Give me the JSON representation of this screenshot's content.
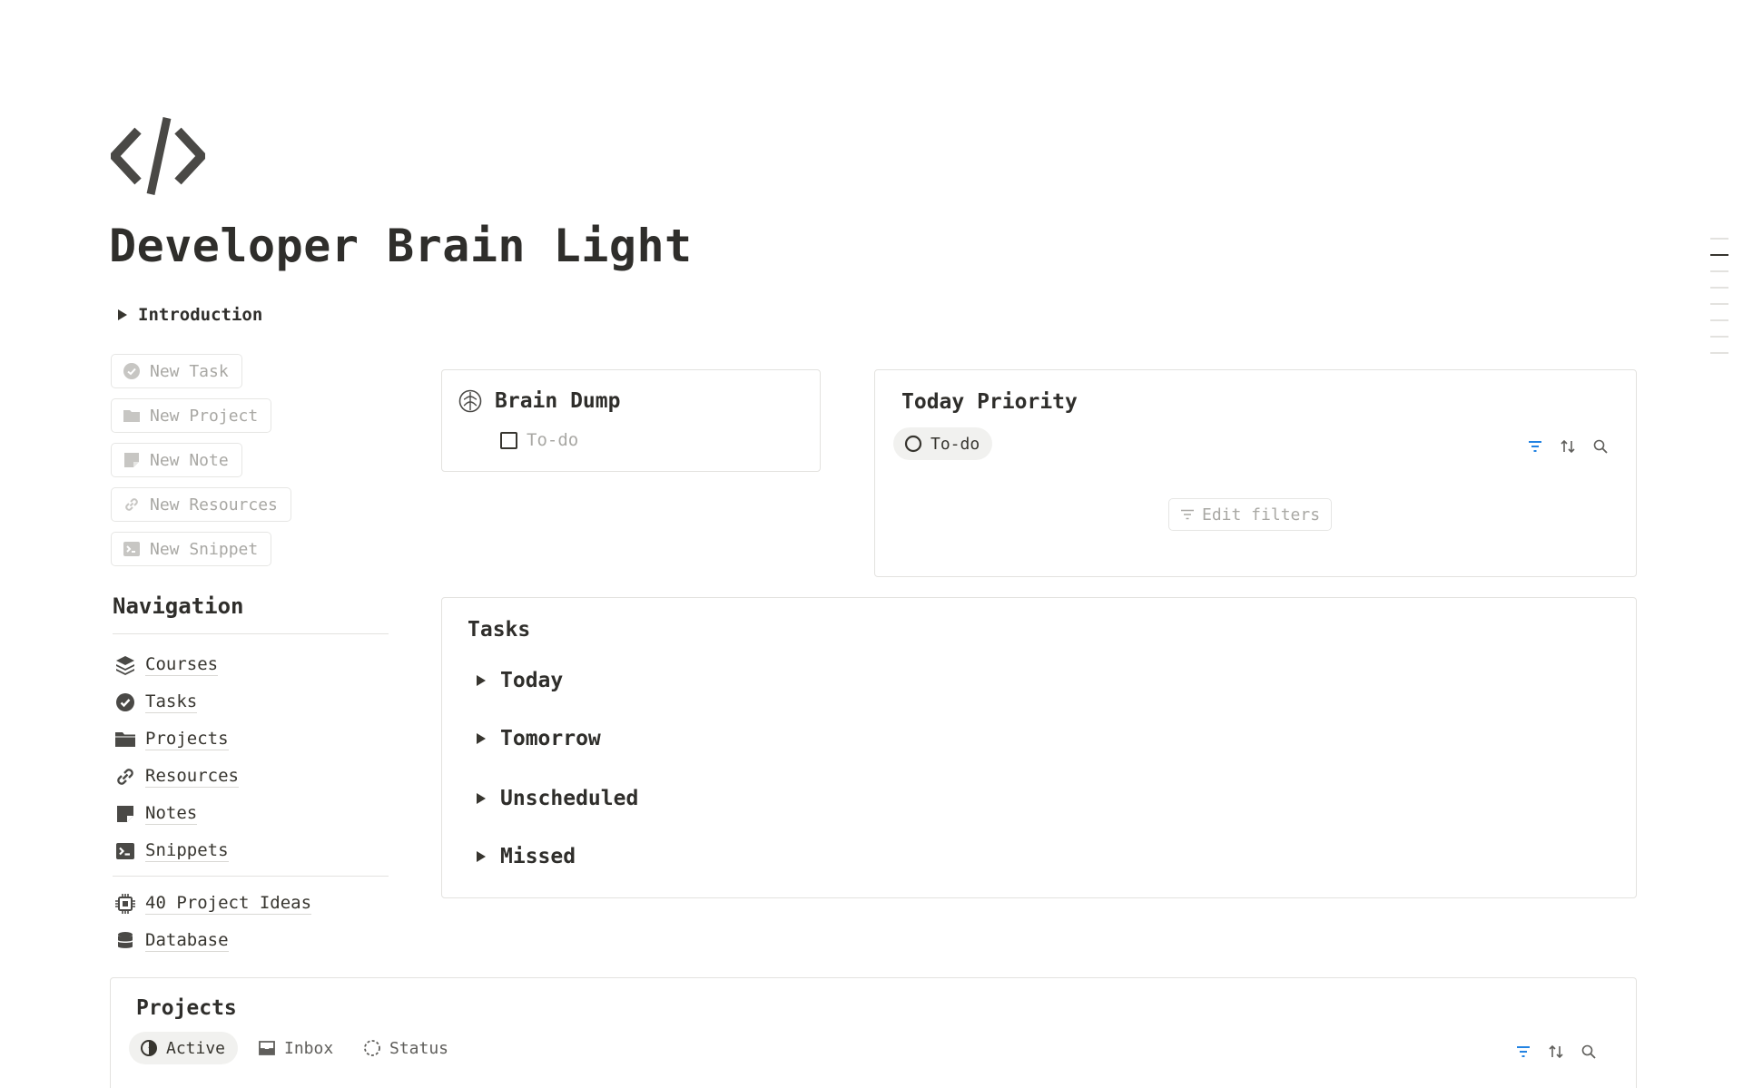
{
  "page": {
    "icon": "code-brackets-icon",
    "title": "Developer Brain Light",
    "intro_toggle": "Introduction"
  },
  "quick_actions": [
    {
      "label": "New Task",
      "icon": "check-circle-icon"
    },
    {
      "label": "New Project",
      "icon": "folder-icon"
    },
    {
      "label": "New Note",
      "icon": "note-icon"
    },
    {
      "label": "New Resources",
      "icon": "link-icon"
    },
    {
      "label": "New Snippet",
      "icon": "terminal-icon"
    }
  ],
  "navigation": {
    "heading": "Navigation",
    "items": [
      {
        "label": "Courses",
        "icon": "layers-icon"
      },
      {
        "label": "Tasks",
        "icon": "check-circle-icon"
      },
      {
        "label": "Projects",
        "icon": "folder-icon"
      },
      {
        "label": "Resources",
        "icon": "link-icon"
      },
      {
        "label": "Notes",
        "icon": "note-icon"
      },
      {
        "label": "Snippets",
        "icon": "terminal-icon"
      }
    ],
    "extra_items": [
      {
        "label": "40 Project Ideas",
        "icon": "chip-icon"
      },
      {
        "label": "Database",
        "icon": "database-icon"
      }
    ]
  },
  "brain_dump": {
    "title": "Brain Dump",
    "icon": "brain-icon",
    "todo_placeholder": "To-do"
  },
  "today_priority": {
    "title": "Today Priority",
    "view_label": "To-do",
    "edit_filters_label": "Edit filters"
  },
  "tasks": {
    "title": "Tasks",
    "groups": [
      "Today",
      "Tomorrow",
      "Unscheduled",
      "Missed"
    ]
  },
  "projects": {
    "title": "Projects",
    "views": [
      "Active",
      "Inbox",
      "Status"
    ]
  },
  "colors": {
    "text": "#37352f",
    "muted": "#a9a8a4",
    "border": "#e3e2df",
    "accent": "#2383e2"
  }
}
